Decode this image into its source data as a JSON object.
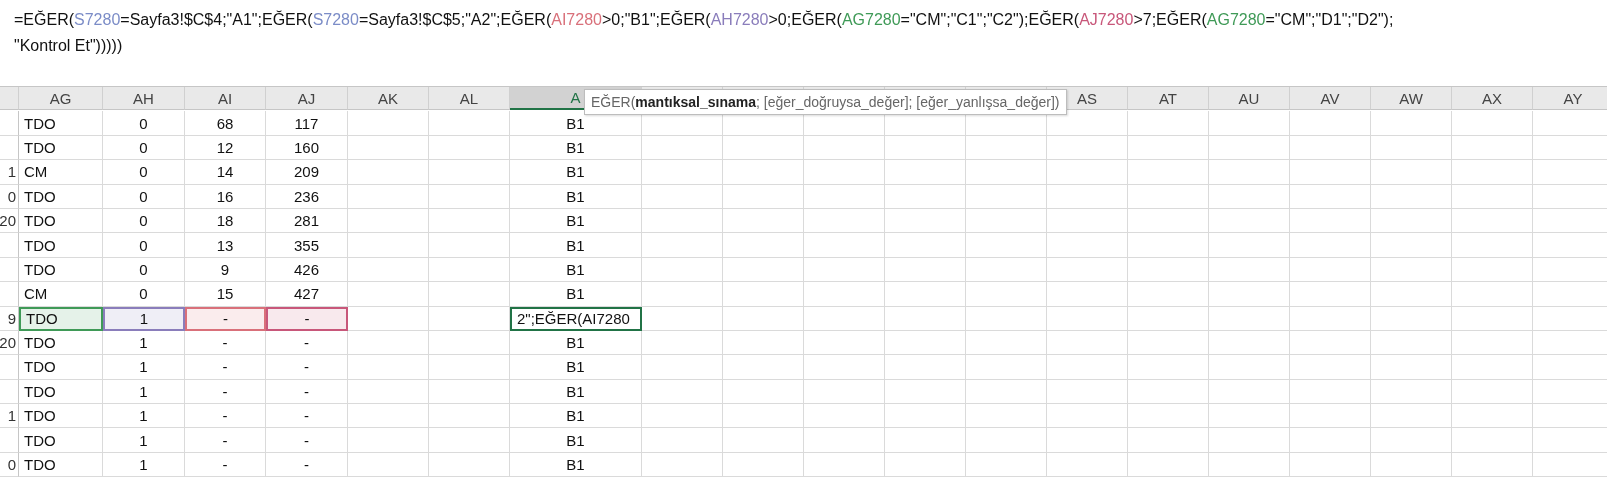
{
  "formula_bar": {
    "lines": [
      [
        {
          "text": "=EĞER("
        },
        {
          "text": "S7280",
          "color": "#7b8cc7"
        },
        {
          "text": "=Sayfa3!$C$4;\"A1\";EĞER("
        },
        {
          "text": "S7280",
          "color": "#7b8cc7"
        },
        {
          "text": "=Sayfa3!$C$5;\"A2\";EĞER("
        },
        {
          "text": "AI7280",
          "color": "#d9707a"
        },
        {
          "text": ">0;\"B1\";EĞER("
        },
        {
          "text": "AH7280",
          "color": "#8a7dbb"
        },
        {
          "text": ">0;EĞER("
        },
        {
          "text": "AG7280",
          "color": "#3f9a57"
        },
        {
          "text": "=\"CM\";\"C1\";\"C2\");EĞER("
        },
        {
          "text": "AJ7280",
          "color": "#c8577a"
        },
        {
          "text": ">7;EĞER("
        },
        {
          "text": "AG7280",
          "color": "#3f9a57"
        },
        {
          "text": "=\"CM\";\"D1\";\"D2\");"
        }
      ],
      [
        {
          "text": "\"Kontrol Et\")))))"
        }
      ]
    ]
  },
  "tooltip": "EĞER(**mantıksal_sınama**; [eğer_doğruysa_değer]; [eğer_yanlışsa_değer])",
  "column_headers": [
    {
      "label": "AG",
      "selected": false
    },
    {
      "label": "AH",
      "selected": false
    },
    {
      "label": "AI",
      "selected": false
    },
    {
      "label": "AJ",
      "selected": false
    },
    {
      "label": "AK",
      "selected": false
    },
    {
      "label": "AL",
      "selected": false
    },
    {
      "label": "A",
      "selected": true
    },
    {
      "selected": false
    },
    {
      "selected": false
    },
    {
      "selected": false
    },
    {
      "selected": false
    },
    {
      "selected": false
    },
    {
      "label": "AS",
      "selected": false
    },
    {
      "label": "AT",
      "selected": false
    },
    {
      "label": "AU",
      "selected": false
    },
    {
      "label": "AV",
      "selected": false
    },
    {
      "label": "AW",
      "selected": false
    },
    {
      "label": "AX",
      "selected": false
    },
    {
      "label": "AY",
      "selected": false
    }
  ],
  "rows": [
    {
      "selected": false,
      "cells": [
        {
          "text": "TDO"
        },
        {
          "text": "0"
        },
        {
          "text": "68"
        },
        {
          "text": "117"
        }
      ],
      "result": "B1"
    },
    {
      "selected": false,
      "cells": [
        {
          "text": "TDO"
        },
        {
          "text": "0"
        },
        {
          "text": "12"
        },
        {
          "text": "160"
        }
      ],
      "result": "B1"
    },
    {
      "row_number": "1",
      "selected": false,
      "cells": [
        {
          "text": "CM"
        },
        {
          "text": "0"
        },
        {
          "text": "14"
        },
        {
          "text": "209"
        }
      ],
      "result": "B1"
    },
    {
      "row_number": "0",
      "selected": false,
      "cells": [
        {
          "text": "TDO"
        },
        {
          "text": "0"
        },
        {
          "text": "16"
        },
        {
          "text": "236"
        }
      ],
      "result": "B1"
    },
    {
      "row_number": "20",
      "selected": false,
      "cells": [
        {
          "text": "TDO"
        },
        {
          "text": "0"
        },
        {
          "text": "18"
        },
        {
          "text": "281"
        }
      ],
      "result": "B1"
    },
    {
      "selected": false,
      "cells": [
        {
          "text": "TDO"
        },
        {
          "text": "0"
        },
        {
          "text": "13"
        },
        {
          "text": "355"
        }
      ],
      "result": "B1"
    },
    {
      "selected": false,
      "cells": [
        {
          "text": "TDO"
        },
        {
          "text": "0"
        },
        {
          "text": "9"
        },
        {
          "text": "426"
        }
      ],
      "result": "B1"
    },
    {
      "selected": false,
      "cells": [
        {
          "text": "CM"
        },
        {
          "text": "0"
        },
        {
          "text": "15"
        },
        {
          "text": "427"
        }
      ],
      "result": "B1"
    },
    {
      "row_number": "9",
      "selected": true,
      "cells": [
        {
          "text": "TDO",
          "color": "#3f9a57"
        },
        {
          "text": "1",
          "color": "#8a7dbb"
        },
        {
          "text": "-",
          "color": "#d9707a"
        },
        {
          "text": "-",
          "color": "#c8577a"
        }
      ],
      "result": "2\";EĞER(AI7280"
    },
    {
      "row_number": "20",
      "selected": false,
      "cells": [
        {
          "text": "TDO"
        },
        {
          "text": "1"
        },
        {
          "text": "-"
        },
        {
          "text": "-"
        }
      ],
      "result": "B1"
    },
    {
      "selected": false,
      "cells": [
        {
          "text": "TDO"
        },
        {
          "text": "1"
        },
        {
          "text": "-"
        },
        {
          "text": "-"
        }
      ],
      "result": "B1"
    },
    {
      "selected": false,
      "cells": [
        {
          "text": "TDO"
        },
        {
          "text": "1"
        },
        {
          "text": "-"
        },
        {
          "text": "-"
        }
      ],
      "result": "B1"
    },
    {
      "row_number": "1",
      "selected": false,
      "cells": [
        {
          "text": "TDO"
        },
        {
          "text": "1"
        },
        {
          "text": "-"
        },
        {
          "text": "-"
        }
      ],
      "result": "B1"
    },
    {
      "selected": false,
      "cells": [
        {
          "text": "TDO"
        },
        {
          "text": "1"
        },
        {
          "text": "-"
        },
        {
          "text": "-"
        }
      ],
      "result": "B1"
    },
    {
      "row_number": "0",
      "selected": false,
      "cells": [
        {
          "text": "TDO"
        },
        {
          "text": "1"
        },
        {
          "text": "-"
        },
        {
          "text": "-"
        }
      ],
      "result": "B1"
    }
  ]
}
